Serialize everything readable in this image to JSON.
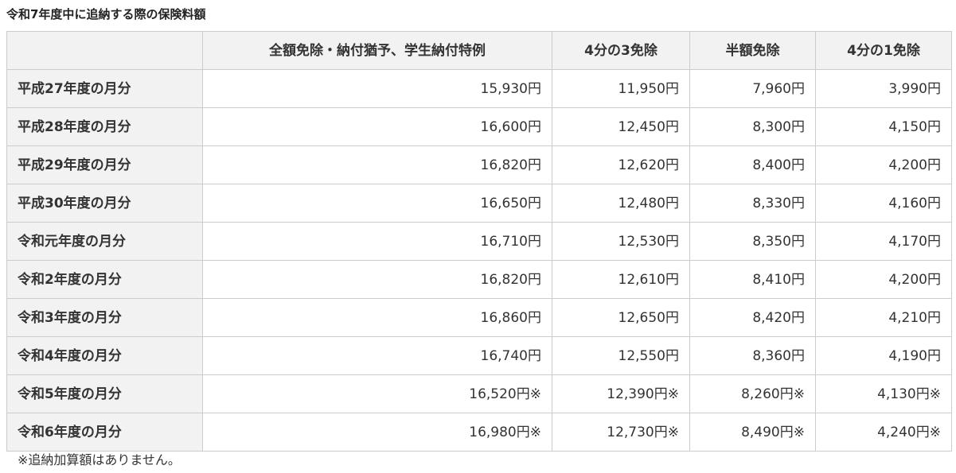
{
  "caption": "令和7年度中に追納する際の保険料額",
  "table": {
    "headers": [
      "",
      "全額免除・納付猶予、学生納付特例",
      "4分の3免除",
      "半額免除",
      "4分の1免除"
    ],
    "rows": [
      {
        "label": "平成27年度の月分",
        "values": [
          "15,930円",
          "11,950円",
          "7,960円",
          "3,990円"
        ]
      },
      {
        "label": "平成28年度の月分",
        "values": [
          "16,600円",
          "12,450円",
          "8,300円",
          "4,150円"
        ]
      },
      {
        "label": "平成29年度の月分",
        "values": [
          "16,820円",
          "12,620円",
          "8,400円",
          "4,200円"
        ]
      },
      {
        "label": "平成30年度の月分",
        "values": [
          "16,650円",
          "12,480円",
          "8,330円",
          "4,160円"
        ]
      },
      {
        "label": "令和元年度の月分",
        "values": [
          "16,710円",
          "12,530円",
          "8,350円",
          "4,170円"
        ]
      },
      {
        "label": "令和2年度の月分",
        "values": [
          "16,820円",
          "12,610円",
          "8,410円",
          "4,200円"
        ]
      },
      {
        "label": "令和3年度の月分",
        "values": [
          "16,860円",
          "12,650円",
          "8,420円",
          "4,210円"
        ]
      },
      {
        "label": "令和4年度の月分",
        "values": [
          "16,740円",
          "12,550円",
          "8,360円",
          "4,190円"
        ]
      },
      {
        "label": "令和5年度の月分",
        "values": [
          "16,520円※",
          "12,390円※",
          "8,260円※",
          "4,130円※"
        ]
      },
      {
        "label": "令和6年度の月分",
        "values": [
          "16,980円※",
          "12,730円※",
          "8,490円※",
          "4,240円※"
        ]
      }
    ]
  },
  "note": "※追納加算額はありません。"
}
